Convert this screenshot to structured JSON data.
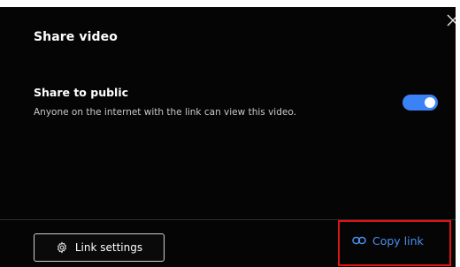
{
  "dialog": {
    "title": "Share video",
    "close_icon": "close-icon"
  },
  "share_public": {
    "heading": "Share to public",
    "description": "Anyone on the internet with the link can view this video.",
    "toggle_on": true
  },
  "footer": {
    "link_settings_label": "Link settings",
    "link_settings_icon": "gear-icon",
    "copy_link_label": "Copy link",
    "copy_link_icon": "link-icon"
  },
  "colors": {
    "background": "#050505",
    "accent": "#3b82f6",
    "link_text": "#4b8ef0",
    "highlight": "#e01414"
  }
}
